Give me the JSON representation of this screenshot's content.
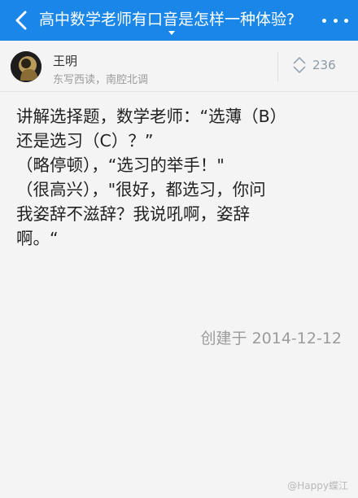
{
  "header": {
    "title": "高中数学老师有口音是怎样一种体验?",
    "bg_color": "#1a87e8"
  },
  "author": {
    "name": "王明",
    "bio": "东写西读，南腔北调"
  },
  "votes": {
    "count": "236"
  },
  "answer": {
    "lines": [
      "讲解选择题，数学老师：“选薄（B）",
      "还是选习（C）？”",
      "（略停顿），“选习的举手！\"",
      "（很高兴），\"很好，都选习，你问",
      "我姿辞不滋辞？我说吼啊，姿辞",
      "啊。“"
    ]
  },
  "footer": {
    "created": "创建于 2014-12-12"
  },
  "watermark": {
    "text": "@Happy蝶江"
  },
  "icons": {
    "back": "chevron-left-icon",
    "more": "more-horizontal-icon",
    "vote": "vote-arrows-icon"
  }
}
